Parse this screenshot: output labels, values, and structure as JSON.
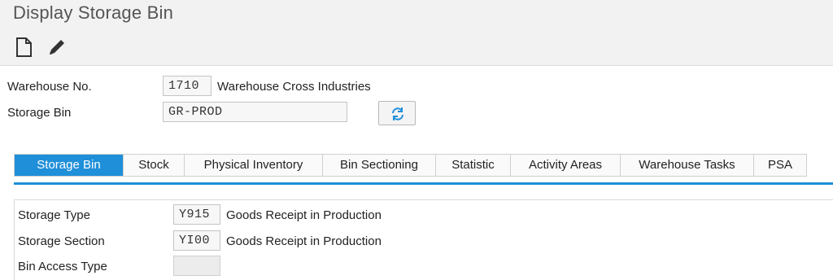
{
  "window": {
    "title": "Display Storage Bin"
  },
  "toolbar": {
    "icons": [
      "new-document-icon",
      "edit-pencil-icon"
    ]
  },
  "header": {
    "warehouse_label": "Warehouse No.",
    "warehouse_value": "1710",
    "warehouse_desc": "Warehouse Cross Industries",
    "bin_label": "Storage Bin",
    "bin_value": "GR-PROD",
    "refresh_icon": "refresh-icon"
  },
  "tabs": [
    {
      "label": "Storage Bin",
      "active": true
    },
    {
      "label": "Stock"
    },
    {
      "label": "Physical Inventory"
    },
    {
      "label": "Bin Sectioning"
    },
    {
      "label": "Statistic"
    },
    {
      "label": "Activity Areas"
    },
    {
      "label": "Warehouse Tasks"
    },
    {
      "label": "PSA"
    }
  ],
  "details": {
    "storage_type_label": "Storage Type",
    "storage_type_value": "Y915",
    "storage_type_desc": "Goods Receipt in Production",
    "storage_section_label": "Storage Section",
    "storage_section_value": "YI00",
    "storage_section_desc": "Goods Receipt in Production",
    "bin_access_label": "Bin Access Type",
    "bin_access_value": ""
  },
  "colors": {
    "accent": "#1f8fd9",
    "bar_bg": "#f2f2f2"
  }
}
